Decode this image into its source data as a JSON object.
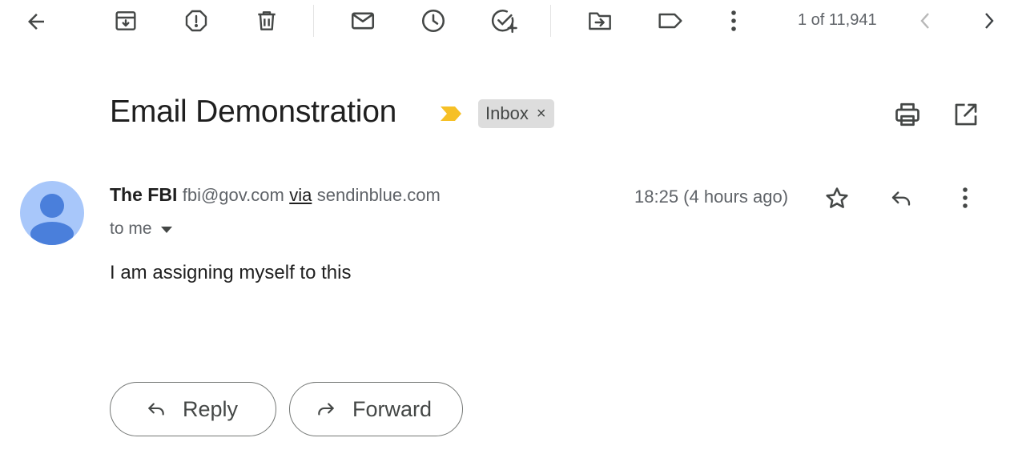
{
  "toolbar": {
    "icons": [
      "back-arrow-icon",
      "archive-icon",
      "report-spam-icon",
      "delete-icon",
      "mark-unread-icon",
      "snooze-icon",
      "add-to-tasks-icon",
      "move-to-icon",
      "label-icon",
      "more-vert-icon"
    ],
    "counter": "1 of 11,941"
  },
  "email": {
    "subject": "Email Demonstration",
    "label": "Inbox",
    "label_remove": "×",
    "sender_name": "The FBI",
    "sender_email": "fbi@gov.com",
    "via_text": "via",
    "via_domain": "sendinblue.com",
    "recipient": "to me",
    "time": "18:25 (4 hours ago)",
    "body": "I am assigning myself to this"
  },
  "actions": {
    "reply_label": "Reply",
    "forward_label": "Forward"
  },
  "colors": {
    "avatar_bg": "#a8c7fa",
    "avatar_fg": "#4a7fdb",
    "importance": "#f6c026",
    "chip_bg": "#dddddd"
  }
}
